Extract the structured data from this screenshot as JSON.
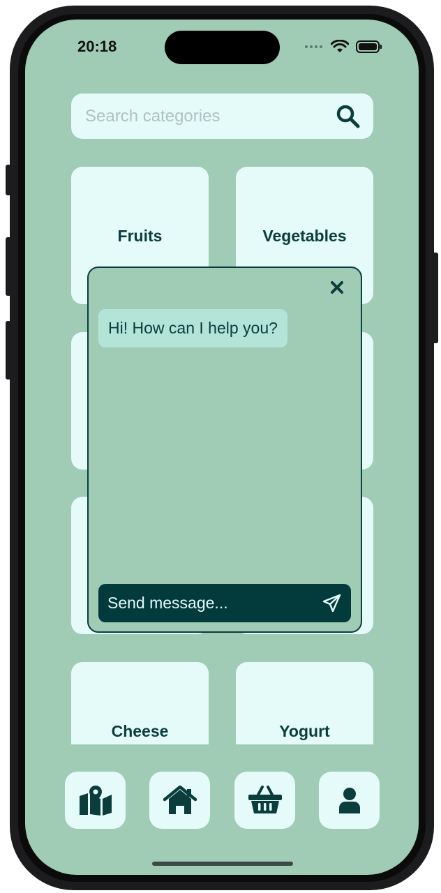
{
  "status_bar": {
    "time": "20:18"
  },
  "search": {
    "placeholder": "Search categories",
    "value": ""
  },
  "categories": [
    {
      "label": "Fruits"
    },
    {
      "label": "Vegetables"
    },
    {
      "label": ""
    },
    {
      "label": ""
    },
    {
      "label": ""
    },
    {
      "label": ""
    },
    {
      "label": "Cheese"
    },
    {
      "label": "Yogurt"
    }
  ],
  "chat": {
    "greeting": "Hi! How can I help you?",
    "input_placeholder": "Send message..."
  },
  "bottom_nav": [
    {
      "icon": "map-icon"
    },
    {
      "icon": "home-icon"
    },
    {
      "icon": "basket-icon"
    },
    {
      "icon": "user-icon"
    }
  ],
  "colors": {
    "background": "#a0cbb4",
    "tile": "#e4fbfa",
    "accent_dark": "#0b3d3d",
    "bubble": "#b4e3d8",
    "input_bar": "#033a3c"
  }
}
